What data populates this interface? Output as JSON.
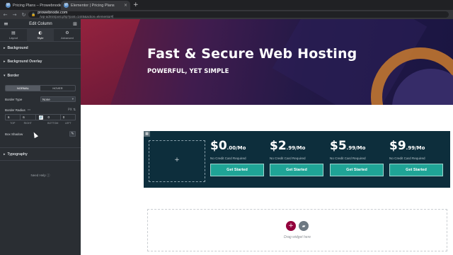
{
  "browser": {
    "tabs": [
      {
        "title": "Pricing Plans – Prowebnode.com",
        "close": "×",
        "active": false
      },
      {
        "title": "Elementor | Pricing Plans",
        "close": "×",
        "active": true
      }
    ],
    "new_tab": "+",
    "back": "←",
    "forward": "→",
    "reload": "↻",
    "lock": "🔒",
    "url_host": "prowebnode.com",
    "url_path": "/wp-admin/post.php?post=1445&action=elementor#"
  },
  "panel": {
    "menu_icon": "≡",
    "title": "Edit Column",
    "grid_icon": "⊞",
    "tabs": [
      {
        "label": "Layout",
        "icon": "▤"
      },
      {
        "label": "Style",
        "icon": "◐"
      },
      {
        "label": "Advanced",
        "icon": "⚙"
      }
    ],
    "sections": {
      "background": "Background",
      "background_overlay": "Background Overlay",
      "border": "Border",
      "typography": "Typography"
    },
    "caret_right": "▸",
    "caret_down": "▾",
    "border": {
      "normal": "NORMAL",
      "hover": "HOVER",
      "type_label": "Border Type",
      "type_value": "None",
      "radius_label": "Border Radius",
      "radius_unit": "PX ⇅",
      "radius_values": {
        "top": "6",
        "right": "6",
        "bottom": "0",
        "left": "0"
      },
      "dim_labels": {
        "top": "TOP",
        "right": "RIGHT",
        "bottom": "BOTTOM",
        "left": "LEFT"
      },
      "link_icon": "🔗",
      "shadow_label": "Box Shadow",
      "shadow_icon": "✎"
    },
    "need_help": "Need Help ⓘ",
    "collapse_icon": "◂"
  },
  "canvas": {
    "hero_title": "Fast & Secure Web Hosting",
    "hero_subtitle": "POWERFUL, YET SIMPLE",
    "column_handle": "▦",
    "empty_column_plus": "+",
    "plans": [
      {
        "price_big": "$0",
        "price_small": ".00/Mo",
        "note": "No Credit Card Required",
        "button": "Get Started"
      },
      {
        "price_big": "$2",
        "price_small": ".99/Mo",
        "note": "No Credit Card Required",
        "button": "Get Started"
      },
      {
        "price_big": "$5",
        "price_small": ".99/Mo",
        "note": "No Credit Card Required",
        "button": "Get Started"
      },
      {
        "price_big": "$9",
        "price_small": ".99/Mo",
        "note": "No Credit Card Required",
        "button": "Get Started"
      }
    ],
    "dropzone": {
      "add_icon": "+",
      "folder_icon": "▰",
      "text": "Drag widget here"
    }
  },
  "colors": {
    "panel_bg": "#2a2e33",
    "pricing_bg": "#0d2e3c",
    "button_teal": "#1fa496",
    "add_button": "#93003c"
  }
}
